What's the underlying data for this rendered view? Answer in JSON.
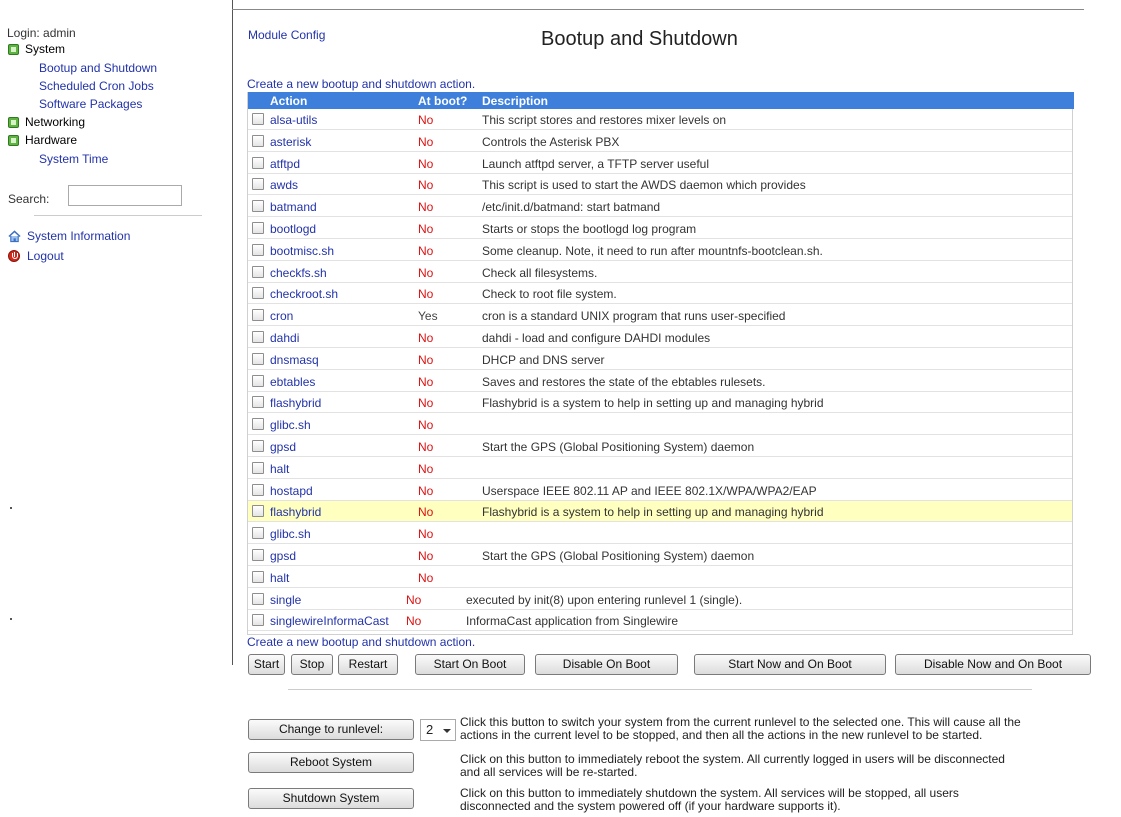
{
  "sidebar": {
    "login": "Login: admin",
    "categories": [
      {
        "label": "System",
        "links": [
          "Bootup and Shutdown",
          "Scheduled Cron Jobs",
          "Software Packages"
        ]
      },
      {
        "label": "Networking",
        "links": []
      },
      {
        "label": "Hardware",
        "links": [
          "System Time"
        ]
      }
    ],
    "search_label": "Search:",
    "search_value": "",
    "system_information": "System Information",
    "logout": "Logout"
  },
  "header": {
    "module_config": "Module Config",
    "title": "Bootup and Shutdown"
  },
  "create_link": "Create a new bootup and shutdown action.",
  "table": {
    "columns": [
      "Action",
      "At boot?",
      "Description"
    ],
    "rows": [
      {
        "name": "alsa-utils",
        "boot": "No",
        "desc": "This script stores and restores mixer levels on"
      },
      {
        "name": "asterisk",
        "boot": "No",
        "desc": "Controls the Asterisk PBX"
      },
      {
        "name": "atftpd",
        "boot": "No",
        "desc": "Launch atftpd server, a TFTP server useful"
      },
      {
        "name": "awds",
        "boot": "No",
        "desc": "This script is used to start the AWDS daemon which provides"
      },
      {
        "name": "batmand",
        "boot": "No",
        "desc": "/etc/init.d/batmand: start batmand"
      },
      {
        "name": "bootlogd",
        "boot": "No",
        "desc": "Starts or stops the bootlogd log program"
      },
      {
        "name": "bootmisc.sh",
        "boot": "No",
        "desc": "Some cleanup. Note, it need to run after mountnfs-bootclean.sh."
      },
      {
        "name": "checkfs.sh",
        "boot": "No",
        "desc": "Check all filesystems."
      },
      {
        "name": "checkroot.sh",
        "boot": "No",
        "desc": "Check to root file system."
      },
      {
        "name": "cron",
        "boot": "Yes",
        "desc": "cron is a standard UNIX program that runs user-specified"
      },
      {
        "name": "dahdi",
        "boot": "No",
        "desc": "dahdi - load and configure DAHDI modules"
      },
      {
        "name": "dnsmasq",
        "boot": "No",
        "desc": "DHCP and DNS server"
      },
      {
        "name": "ebtables",
        "boot": "No",
        "desc": "Saves and restores the state of the ebtables rulesets."
      },
      {
        "name": "flashybrid",
        "boot": "No",
        "desc": "Flashybrid is a system to help in setting up and managing hybrid"
      },
      {
        "name": "glibc.sh",
        "boot": "No",
        "desc": ""
      },
      {
        "name": "gpsd",
        "boot": "No",
        "desc": "Start the GPS (Global Positioning System) daemon"
      },
      {
        "name": "halt",
        "boot": "No",
        "desc": ""
      },
      {
        "name": "hostapd",
        "boot": "No",
        "desc": "Userspace IEEE 802.11 AP and IEEE 802.1X/WPA/WPA2/EAP"
      },
      {
        "name": "flashybrid",
        "boot": "No",
        "desc": "Flashybrid is a system to help in setting up and managing hybrid",
        "highlighted": true
      },
      {
        "name": "glibc.sh",
        "boot": "No",
        "desc": ""
      },
      {
        "name": "gpsd",
        "boot": "No",
        "desc": "Start the GPS (Global Positioning System) daemon"
      },
      {
        "name": "halt",
        "boot": "No",
        "desc": ""
      },
      {
        "name": "single",
        "boot": "No",
        "desc": "executed by init(8) upon entering runlevel 1 (single)."
      },
      {
        "name": "singlewireInformaCast",
        "boot": "No",
        "desc": "InformaCast application from Singlewire"
      }
    ]
  },
  "actions": {
    "start": "Start",
    "stop": "Stop",
    "restart": "Restart",
    "start_on_boot": "Start On Boot",
    "disable_on_boot": "Disable On Boot",
    "start_now_and_on_boot": "Start Now and On Boot",
    "disable_now_and_on_boot": "Disable Now and On Boot"
  },
  "system_actions": {
    "change_runlevel": "Change to runlevel:",
    "runlevel_value": "2",
    "change_runlevel_help_1": "Click this button to switch your system from the current runlevel to the selected one. This will cause all the",
    "change_runlevel_help_2": "actions in the current level to be stopped, and then all the actions in the new runlevel to be started.",
    "reboot": "Reboot System",
    "reboot_help_1": "Click on this button to immediately reboot the system. All currently logged in users will be disconnected",
    "reboot_help_2": "and all services will be re-started.",
    "shutdown": "Shutdown System",
    "shutdown_help_1": "Click on this button to immediately shutdown the system. All services will be stopped, all users",
    "shutdown_help_2": "disconnected and the system powered off (if your hardware supports it)."
  },
  "colors": {
    "header_blue": "#3d7fdb",
    "status_no": "#dd1111",
    "highlight_row": "#ffffbf",
    "link": "#2233aa"
  }
}
